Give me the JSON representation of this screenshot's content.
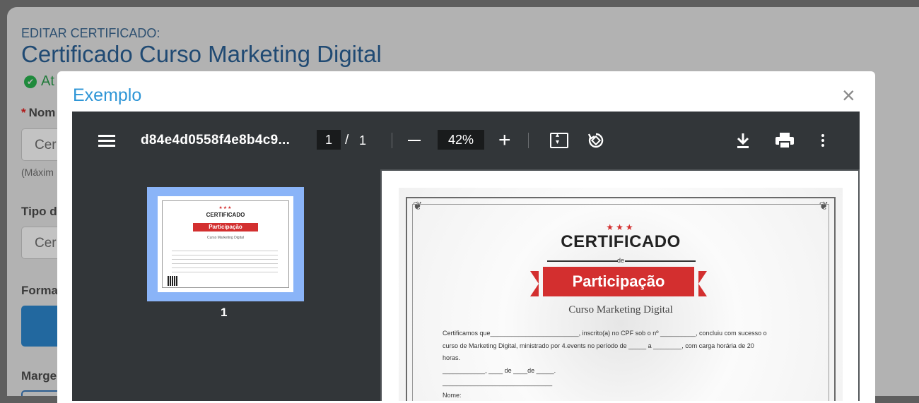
{
  "background_page": {
    "subtitle": "EDITAR CERTIFICADO:",
    "title": "Certificado Curso Marketing Digital",
    "status_text": "At",
    "name_label": "Nom",
    "name_value": "Cer",
    "name_hint": "(Máxim",
    "type_label": "Tipo d",
    "type_value": "Cer",
    "format_label": "Forma",
    "margin_label": "Marge"
  },
  "modal": {
    "title": "Exemplo",
    "close_label": "×"
  },
  "pdf_viewer": {
    "filename": "d84e4d0558f4e8b4c9...",
    "current_page": "1",
    "page_separator": "/",
    "total_pages": "1",
    "zoom": "42%",
    "plus_label": "+",
    "thumbnail_number": "1"
  },
  "thumbnail": {
    "title": "CERTIFICADO",
    "ribbon": "Participação",
    "course": "Curso Marketing Digital"
  },
  "certificate": {
    "stars": "★★★",
    "title": "CERTIFICADO",
    "de": "de",
    "ribbon": "Participação",
    "course": "Curso Marketing Digital",
    "line1": "Certificamos que_________________________, inscrito(a) no CPF sob o nº __________, concluiu com sucesso o",
    "line2": "curso de Marketing Digital, ministrado por 4.events no período de _____ a ________, com carga horária de 20",
    "line3": "horas.",
    "line4": "____________, ____ de ____de _____.",
    "line5": "_______________________________",
    "line6": "Nome:"
  },
  "colors": {
    "brand_blue": "#2d95d6",
    "ribbon_red": "#d32f2f",
    "toolbar": "#323639"
  }
}
